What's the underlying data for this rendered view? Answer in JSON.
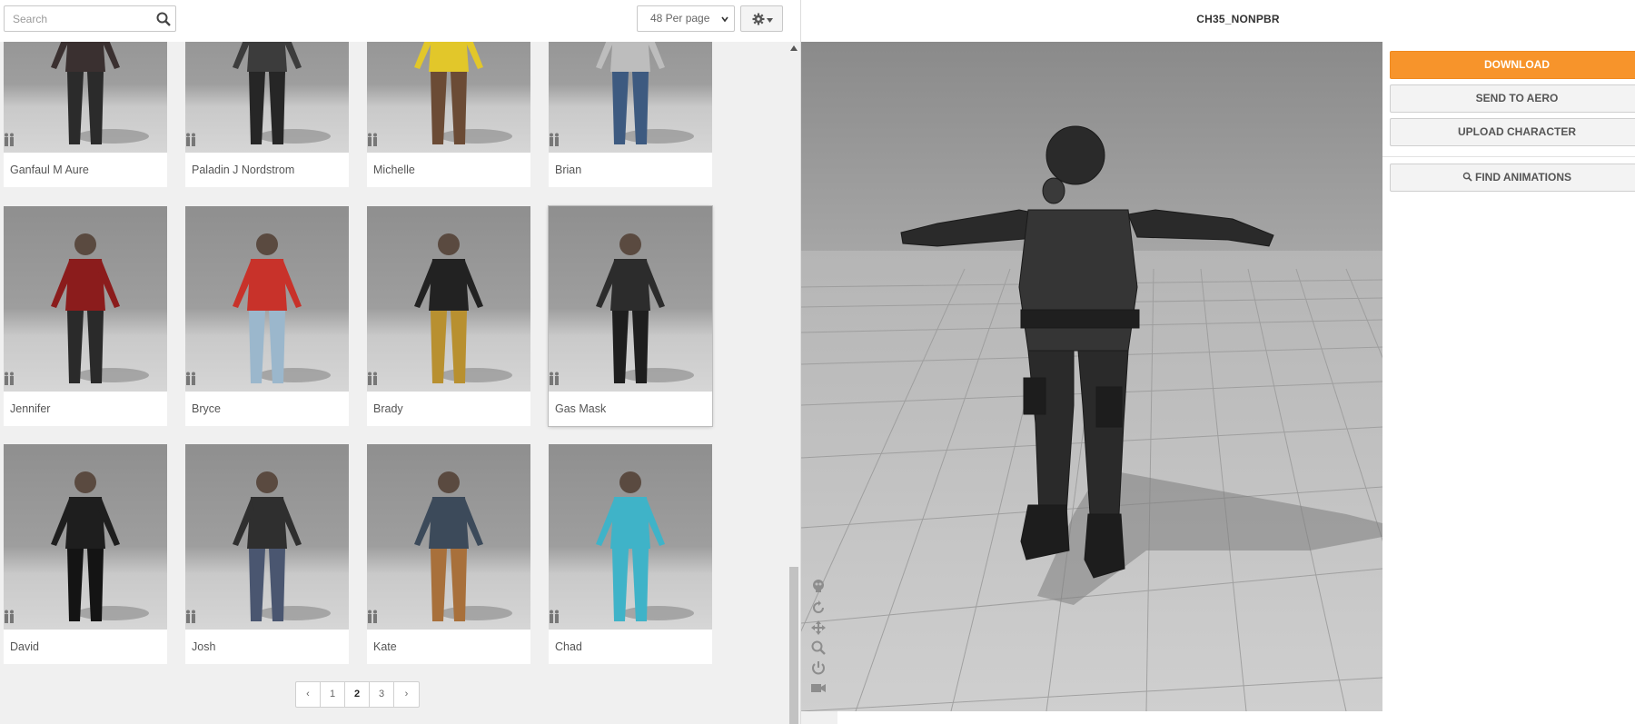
{
  "search": {
    "placeholder": "Search",
    "value": ""
  },
  "toolbar": {
    "per_page_label": "48 Per page",
    "settings_icon": "gear-icon"
  },
  "characters": [
    {
      "name": "Ganfaul M Aure"
    },
    {
      "name": "Paladin J Nordstrom"
    },
    {
      "name": "Michelle"
    },
    {
      "name": "Brian"
    },
    {
      "name": "Jennifer"
    },
    {
      "name": "Bryce"
    },
    {
      "name": "Brady"
    },
    {
      "name": "Gas Mask",
      "selected": true
    },
    {
      "name": "David"
    },
    {
      "name": "Josh"
    },
    {
      "name": "Kate"
    },
    {
      "name": "Chad"
    }
  ],
  "pagination": {
    "prev": "‹",
    "pages": [
      "1",
      "2",
      "3"
    ],
    "current": "2",
    "next": "›"
  },
  "viewer": {
    "title": "CH35_NONPBR"
  },
  "actions": {
    "download": "DOWNLOAD",
    "send_to_aero": "SEND TO AERO",
    "upload_character": "UPLOAD CHARACTER",
    "find_animations": "FIND ANIMATIONS"
  },
  "colors": {
    "accent": "#f7942b",
    "panel_bg": "#f0f0f0",
    "thumb_bg": "#9e9e9e"
  }
}
